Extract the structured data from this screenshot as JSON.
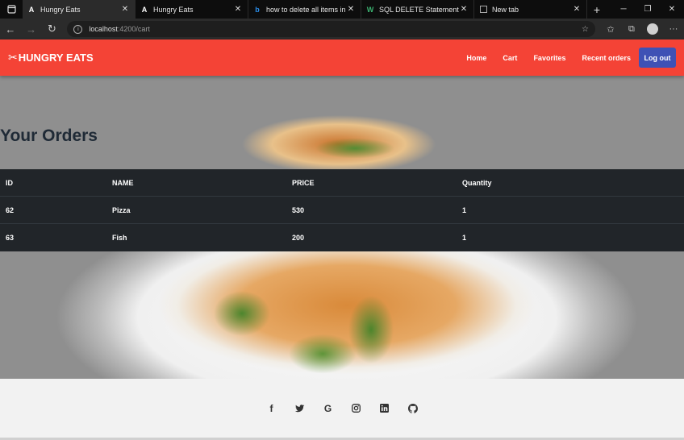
{
  "browser": {
    "tabs": [
      {
        "title": "Hungry Eats",
        "favicon": "A",
        "active": true
      },
      {
        "title": "Hungry Eats",
        "favicon": "A",
        "active": false
      },
      {
        "title": "how to delete all items in table i",
        "favicon": "b",
        "active": false
      },
      {
        "title": "SQL DELETE Statement",
        "favicon": "W",
        "active": false
      },
      {
        "title": "New tab",
        "favicon": "",
        "active": false
      }
    ],
    "url_host": "localhost",
    "url_path": ":4200/cart"
  },
  "navbar": {
    "brand": "HUNGRY EATS",
    "links": [
      "Home",
      "Cart",
      "Favorites",
      "Recent orders"
    ],
    "logout": "Log out",
    "color": "#f44336",
    "button_color": "#3f51b5"
  },
  "page_title": "Your Orders",
  "orders": {
    "columns": [
      "ID",
      "NAME",
      "PRICE",
      "Quantity"
    ],
    "rows": [
      [
        "62",
        "Pizza",
        "530",
        "1"
      ],
      [
        "63",
        "Fish",
        "200",
        "1"
      ]
    ]
  },
  "footer": {
    "icons": [
      "facebook-icon",
      "twitter-icon",
      "google-icon",
      "instagram-icon",
      "linkedin-icon",
      "github-icon"
    ]
  }
}
